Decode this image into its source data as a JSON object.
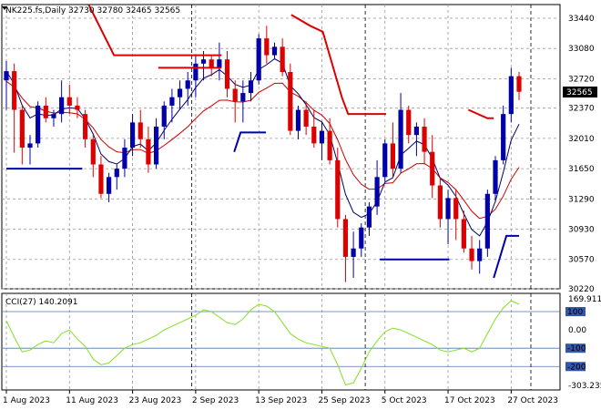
{
  "header": {
    "symbol_line": "NK225.fs,Daily  32730 32780 32465 32565"
  },
  "indicator": {
    "label": "CCI(27) 140.2091"
  },
  "colors": {
    "bull": "#0000aa",
    "bear": "#dd0000",
    "ma_fast": "#000066",
    "ma_slow": "#cc0000",
    "cci": "#80e020",
    "grid": "#999999",
    "level": "#5577aa"
  },
  "chart_data": [
    {
      "type": "candlestick",
      "title": "",
      "ylim": [
        30220,
        33600
      ],
      "y_ticks": [
        33440,
        33080,
        32720,
        32370,
        32010,
        31650,
        31290,
        30930,
        30570,
        30220
      ],
      "last_price": 32565,
      "last_price_label": "32565",
      "x_labels": [
        "1 Aug 2023",
        "11 Aug 2023",
        "23 Aug 2023",
        "2 Sep 2023",
        "13 Sep 2023",
        "25 Sep 2023",
        "5 Oct 2023",
        "17 Oct 2023",
        "27 Oct 2023"
      ],
      "x_label_index": [
        0,
        8,
        16,
        24,
        32,
        40,
        48,
        56,
        64
      ],
      "session_separators": [
        23,
        45,
        66
      ],
      "candles": [
        [
          32700,
          32930,
          32350,
          32810
        ],
        [
          32810,
          32900,
          31840,
          32350
        ],
        [
          32350,
          32400,
          31700,
          31900
        ],
        [
          31900,
          32050,
          31700,
          31950
        ],
        [
          31950,
          32450,
          31900,
          32400
        ],
        [
          32400,
          32500,
          32200,
          32250
        ],
        [
          32250,
          32350,
          32150,
          32300
        ],
        [
          32300,
          32700,
          32200,
          32500
        ],
        [
          32500,
          32650,
          32300,
          32400
        ],
        [
          32400,
          32500,
          32250,
          32350
        ],
        [
          32300,
          32350,
          31900,
          32000
        ],
        [
          32000,
          32050,
          31550,
          31700
        ],
        [
          31700,
          31800,
          31300,
          31350
        ],
        [
          31350,
          31600,
          31250,
          31550
        ],
        [
          31550,
          31700,
          31400,
          31650
        ],
        [
          31650,
          32000,
          31550,
          31900
        ],
        [
          31900,
          32300,
          31800,
          32200
        ],
        [
          32200,
          32350,
          31900,
          32000
        ],
        [
          32000,
          32150,
          31600,
          31700
        ],
        [
          31700,
          32250,
          31650,
          32150
        ],
        [
          32150,
          32450,
          32000,
          32400
        ],
        [
          32400,
          32600,
          32200,
          32500
        ],
        [
          32500,
          32700,
          32350,
          32600
        ],
        [
          32600,
          32800,
          32400,
          32700
        ],
        [
          32700,
          33000,
          32500,
          32900
        ],
        [
          32900,
          33050,
          32700,
          32950
        ],
        [
          32950,
          33000,
          32750,
          32850
        ],
        [
          32850,
          33150,
          32700,
          32950
        ],
        [
          32950,
          33050,
          32500,
          32600
        ],
        [
          32600,
          32700,
          32200,
          32450
        ],
        [
          32450,
          32700,
          32200,
          32550
        ],
        [
          32550,
          32800,
          32450,
          32700
        ],
        [
          32700,
          33250,
          32650,
          33200
        ],
        [
          33200,
          33350,
          32900,
          33000
        ],
        [
          33000,
          33150,
          32950,
          33100
        ],
        [
          33100,
          33200,
          32750,
          32800
        ],
        [
          32800,
          32900,
          32050,
          32100
        ],
        [
          32100,
          32400,
          32000,
          32350
        ],
        [
          32350,
          32450,
          32050,
          32150
        ],
        [
          32150,
          32350,
          31900,
          31950
        ],
        [
          31950,
          32200,
          31750,
          32100
        ],
        [
          32100,
          32250,
          31700,
          31750
        ],
        [
          31750,
          31900,
          30950,
          31050
        ],
        [
          31050,
          31100,
          30300,
          30600
        ],
        [
          30600,
          30900,
          30350,
          30700
        ],
        [
          30700,
          31000,
          30600,
          30950
        ],
        [
          30950,
          31250,
          30850,
          31200
        ],
        [
          31200,
          31750,
          31100,
          31550
        ],
        [
          31550,
          32000,
          31500,
          31950
        ],
        [
          31950,
          32200,
          31550,
          31650
        ],
        [
          31650,
          32550,
          31600,
          32350
        ],
        [
          32350,
          32400,
          31950,
          32050
        ],
        [
          32050,
          32200,
          31800,
          32150
        ],
        [
          32150,
          32250,
          31700,
          31850
        ],
        [
          31850,
          32050,
          31300,
          31450
        ],
        [
          31450,
          31550,
          30950,
          31050
        ],
        [
          31050,
          31400,
          30750,
          31300
        ],
        [
          31300,
          31400,
          30800,
          31050
        ],
        [
          31050,
          31150,
          30650,
          30700
        ],
        [
          30700,
          30850,
          30450,
          30550
        ],
        [
          30550,
          30800,
          30400,
          30700
        ],
        [
          30700,
          31400,
          30600,
          31350
        ],
        [
          31350,
          31800,
          31250,
          31750
        ],
        [
          31750,
          32400,
          31700,
          32300
        ],
        [
          32300,
          32850,
          32200,
          32750
        ],
        [
          32750,
          32800,
          32465,
          32565
        ]
      ]
    },
    {
      "type": "line",
      "title": "",
      "ylim": [
        -303.235,
        169.9113
      ],
      "y_ticks": [
        169.9113,
        100,
        0.0,
        -100,
        -200,
        -303.235
      ],
      "y_tick_labels": [
        "169.9113",
        "100",
        "0.00",
        "-100",
        "-200",
        "-303.235"
      ],
      "levels": [
        100,
        -100,
        -200
      ],
      "last_value": 140.2091,
      "values": [
        50,
        -40,
        -120,
        -110,
        -80,
        -60,
        -70,
        -20,
        0,
        -50,
        -90,
        -160,
        -190,
        -180,
        -140,
        -100,
        -80,
        -70,
        -50,
        -30,
        0,
        20,
        40,
        60,
        80,
        110,
        100,
        70,
        40,
        30,
        60,
        110,
        140,
        130,
        100,
        40,
        -20,
        -50,
        -70,
        -80,
        -90,
        -100,
        -190,
        -300,
        -290,
        -210,
        -120,
        -60,
        -10,
        10,
        0,
        -20,
        -40,
        -60,
        -80,
        -110,
        -120,
        -110,
        -100,
        -120,
        -100,
        -20,
        60,
        120,
        160,
        140
      ]
    }
  ]
}
